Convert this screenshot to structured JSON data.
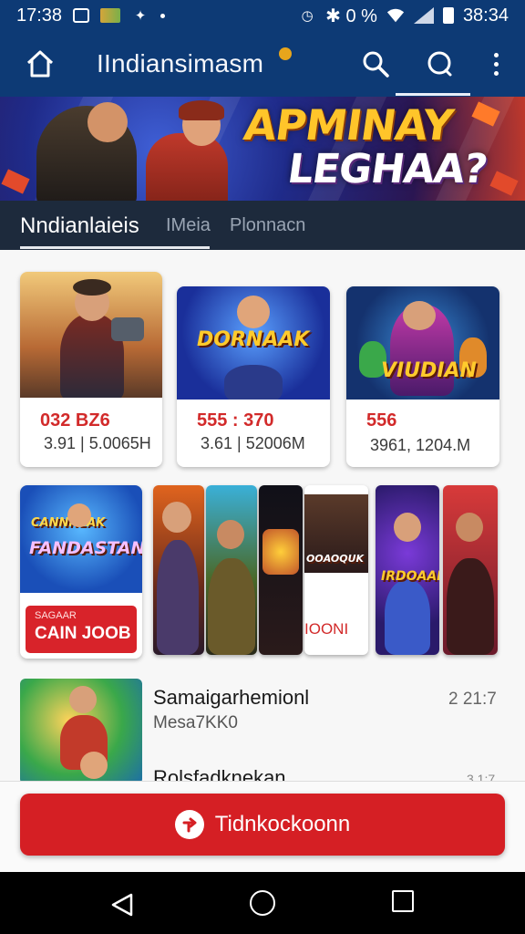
{
  "status_bar": {
    "time": "17:38",
    "indicators": "✱ 0 %",
    "battery_text": "38:34"
  },
  "app_bar": {
    "title": "IIndiansimasm",
    "icons": [
      "home-icon",
      "search-icon",
      "search-icon",
      "more-vert-icon"
    ]
  },
  "banner": {
    "line1": "APMINAY",
    "line2": "LEGHAA?"
  },
  "tabs": [
    {
      "label": "Nndianlaieis"
    },
    {
      "label": "IMeia"
    },
    {
      "label": "Plonnacn"
    }
  ],
  "cards_row1": [
    {
      "price": "032 BZ6",
      "sub": "3.91 | 5.0065H",
      "art_title": ""
    },
    {
      "price": "555 : 370",
      "sub": "3.61 | 52006M",
      "art_title": "DORNAAK"
    },
    {
      "price": "556",
      "sub": "3961, 1204.M",
      "art_title": "VIUDIAN"
    }
  ],
  "card_row2": {
    "art_title": "FANDASTAN",
    "art_top": "CANNNEAK",
    "button_small": "SAGAAR",
    "button_main": "CAIN JOOB"
  },
  "strips": [
    {
      "label": ""
    },
    {
      "label": ""
    },
    {
      "label": ""
    },
    {
      "label": "OOAOQUK",
      "footer": "IOONI"
    },
    {
      "label": "IRDOAAK"
    }
  ],
  "list": [
    {
      "title": "Samaigarhemionl",
      "sub": "Mesa7KK0",
      "time": "2 21:7"
    },
    {
      "title": "Rolsfadknekan",
      "time": "3 1:7"
    }
  ],
  "cta": {
    "label": "Tidnkockoonn",
    "color": "#d51f24"
  },
  "colors": {
    "primary": "#0d3a75",
    "tab_bar": "#1d2a3c",
    "accent": "#d51f24"
  }
}
